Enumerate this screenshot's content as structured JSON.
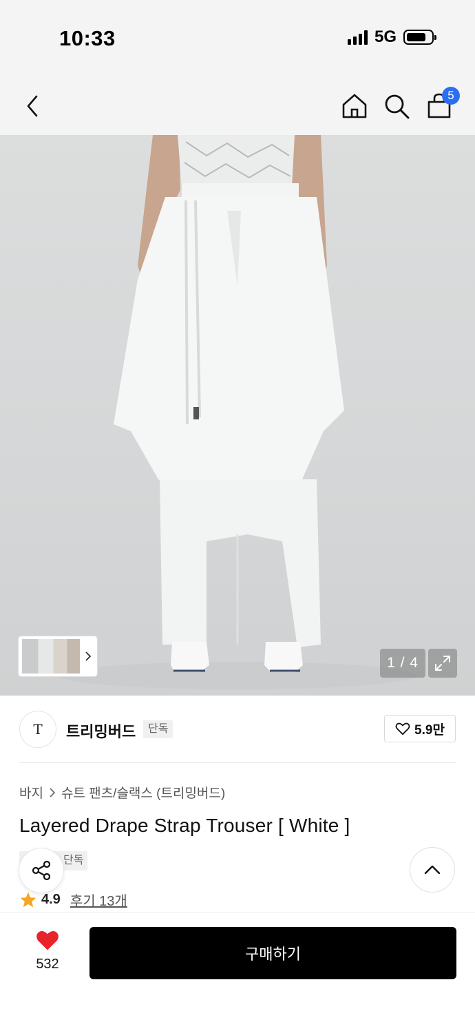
{
  "status_bar": {
    "time": "10:33",
    "network": "5G"
  },
  "nav": {
    "cart_count": "5"
  },
  "gallery": {
    "counter": "1 / 4"
  },
  "brand": {
    "logo_text": "T",
    "name": "트리밍버드",
    "tag": "단독",
    "likes": "5.9만"
  },
  "breadcrumb": {
    "category": "바지",
    "subcategory": "슈트 팬츠/슬랙스 (트리밍버드)"
  },
  "product": {
    "title": "Layered Drape Strap Trouser [ White ]",
    "tag": "단독",
    "rating": "4.9",
    "reviews": "후기 13개"
  },
  "bottom_bar": {
    "wish_count": "532",
    "buy_label": "구매하기"
  },
  "colors": {
    "badge": "#2a6ef2",
    "heart": "#e8232b",
    "star": "#f5a623",
    "buy_bg": "#000000"
  },
  "icons": [
    "back-icon",
    "home-icon",
    "search-icon",
    "cart-icon",
    "chevron-right-icon",
    "expand-icon",
    "heart-outline-icon",
    "share-icon",
    "chevron-up-icon",
    "star-icon",
    "heart-filled-icon"
  ]
}
